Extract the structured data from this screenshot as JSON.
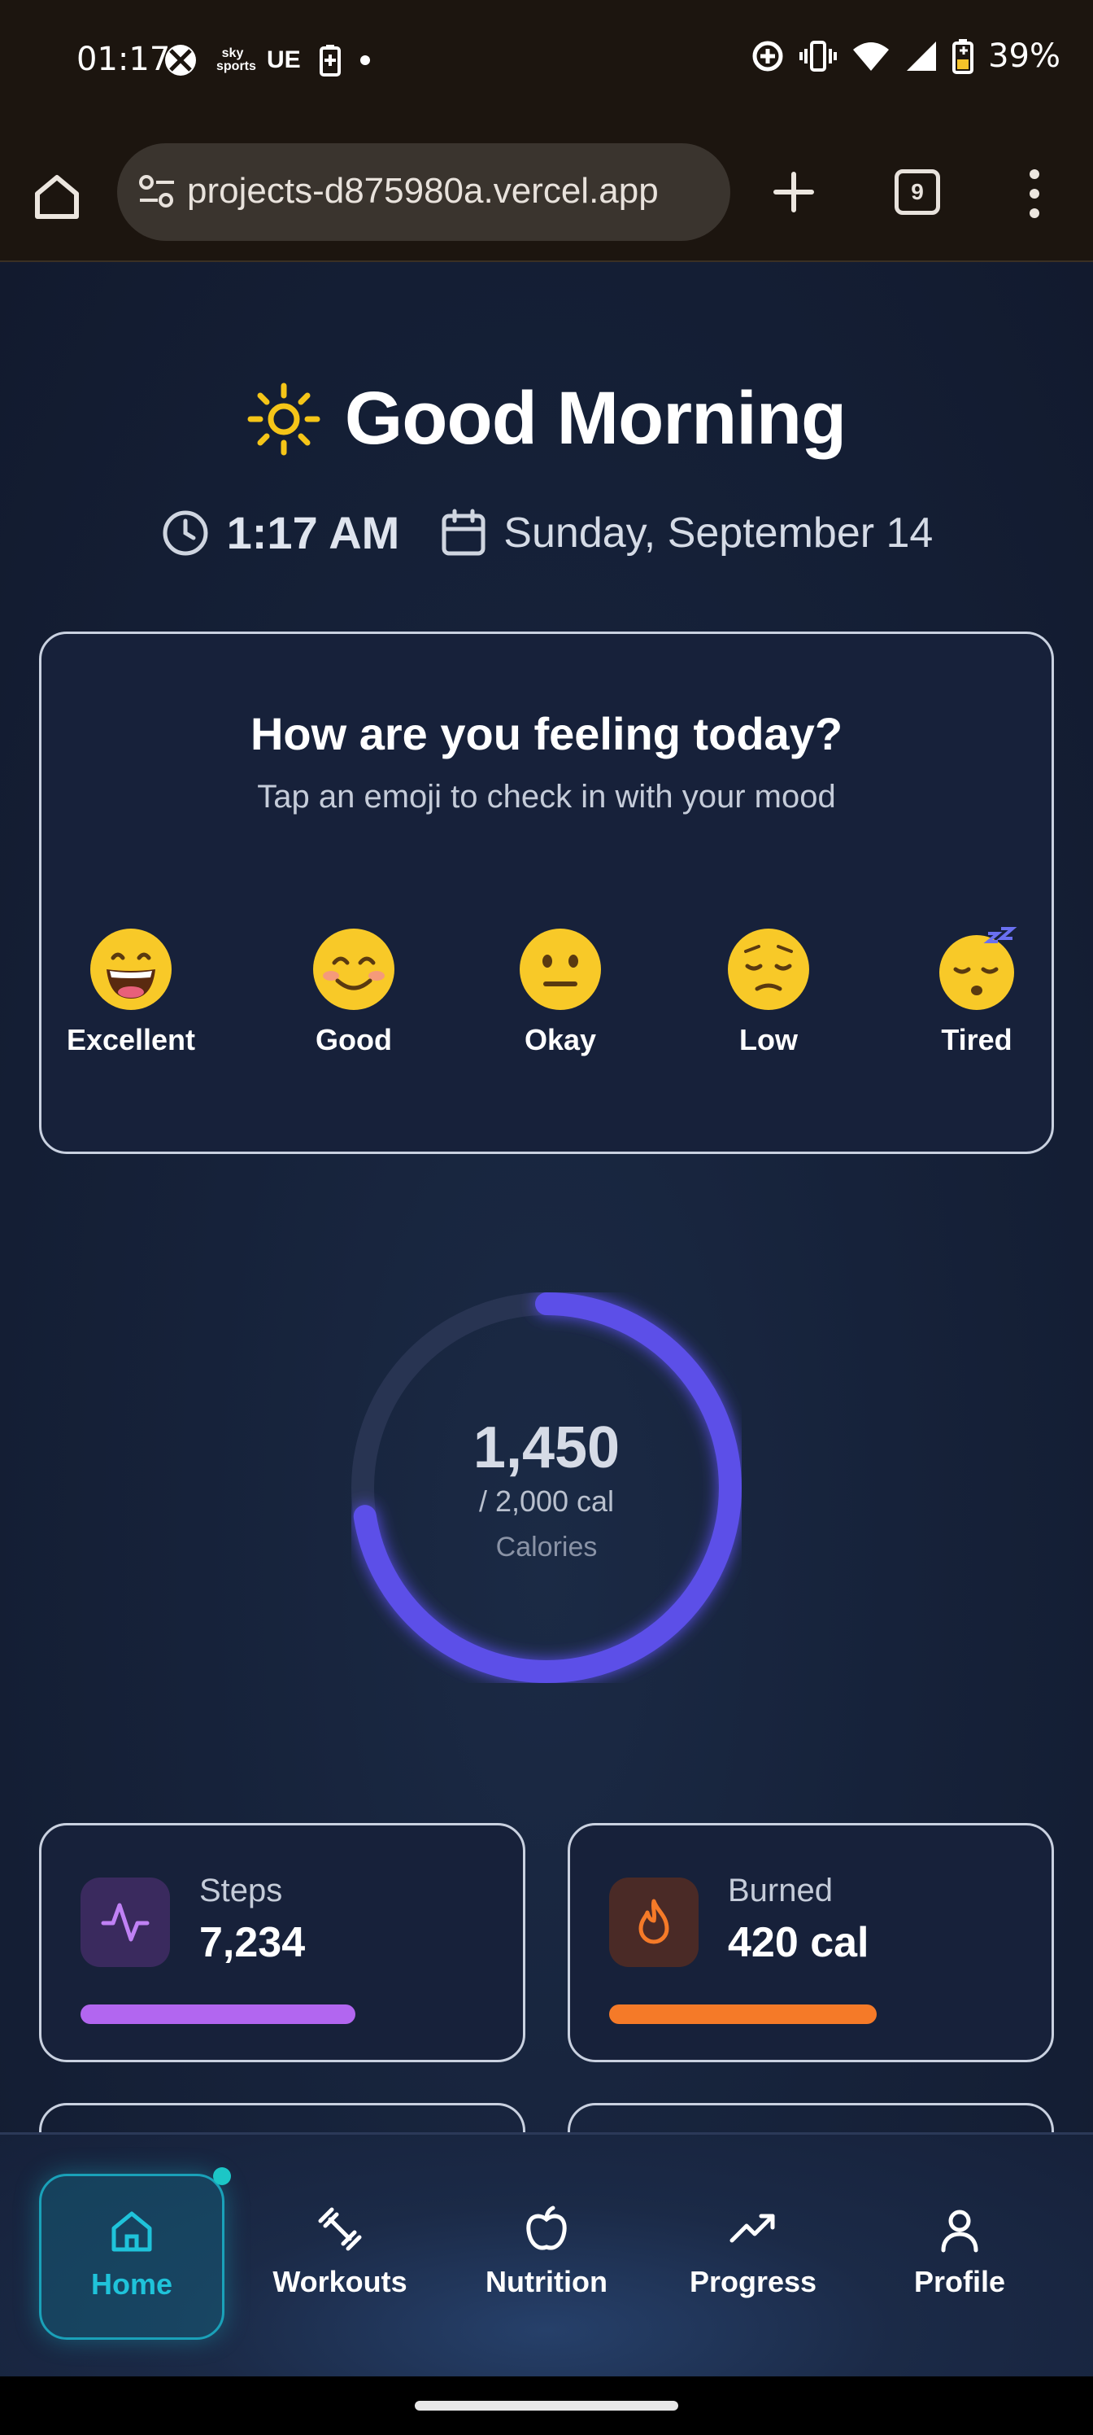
{
  "status_bar": {
    "time": "01:17",
    "carrier_icons": [
      "xbox-icon",
      "sky-sports-icon",
      "ue-icon",
      "battery-saver-icon",
      "dot-icon"
    ],
    "sky_text": "sky sports",
    "ue_text": "UE",
    "battery": "39%"
  },
  "browser": {
    "url": "projects-d875980a.vercel.app",
    "tab_count": "9"
  },
  "greeting": {
    "title": "Good Morning",
    "time": "1:17 AM",
    "date": "Sunday, September 14"
  },
  "mood": {
    "title": "How are you feeling today?",
    "subtitle": "Tap an emoji to check in with your mood",
    "options": [
      {
        "label": "Excellent",
        "emoji": "grinning-face"
      },
      {
        "label": "Good",
        "emoji": "smiling-face"
      },
      {
        "label": "Okay",
        "emoji": "neutral-face"
      },
      {
        "label": "Low",
        "emoji": "pensive-face"
      },
      {
        "label": "Tired",
        "emoji": "sleeping-face"
      }
    ]
  },
  "calories": {
    "value": "1,450",
    "goal": "/ 2,000 cal",
    "label": "Calories",
    "progress": 0.725,
    "color": "#5b50e8"
  },
  "stats": [
    {
      "label": "Steps",
      "value": "7,234",
      "icon": "activity-icon",
      "color": "#b266f0",
      "progress": 0.72
    },
    {
      "label": "Burned",
      "value": "420 cal",
      "icon": "flame-icon",
      "color": "#f57a28",
      "progress": 0.7
    }
  ],
  "nav": {
    "items": [
      {
        "label": "Home",
        "icon": "home-icon",
        "active": true
      },
      {
        "label": "Workouts",
        "icon": "dumbbell-icon",
        "active": false
      },
      {
        "label": "Nutrition",
        "icon": "apple-icon",
        "active": false
      },
      {
        "label": "Progress",
        "icon": "trending-up-icon",
        "active": false
      },
      {
        "label": "Profile",
        "icon": "user-icon",
        "active": false
      }
    ],
    "active_color": "#1fc3da"
  }
}
